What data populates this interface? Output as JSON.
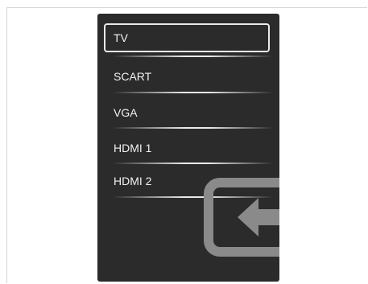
{
  "source_menu": {
    "items": [
      {
        "label": "TV",
        "selected": true
      },
      {
        "label": "SCART",
        "selected": false
      },
      {
        "label": "VGA",
        "selected": false
      },
      {
        "label": "HDMI 1",
        "selected": false
      },
      {
        "label": "HDMI 2",
        "selected": false
      }
    ],
    "decoration_icon": "input-source-icon",
    "colors": {
      "panel_bg": "#2b2b2b",
      "text": "#f2f2f2",
      "highlight_border": "#eaeaea",
      "icon": "#8a8a8a"
    }
  }
}
